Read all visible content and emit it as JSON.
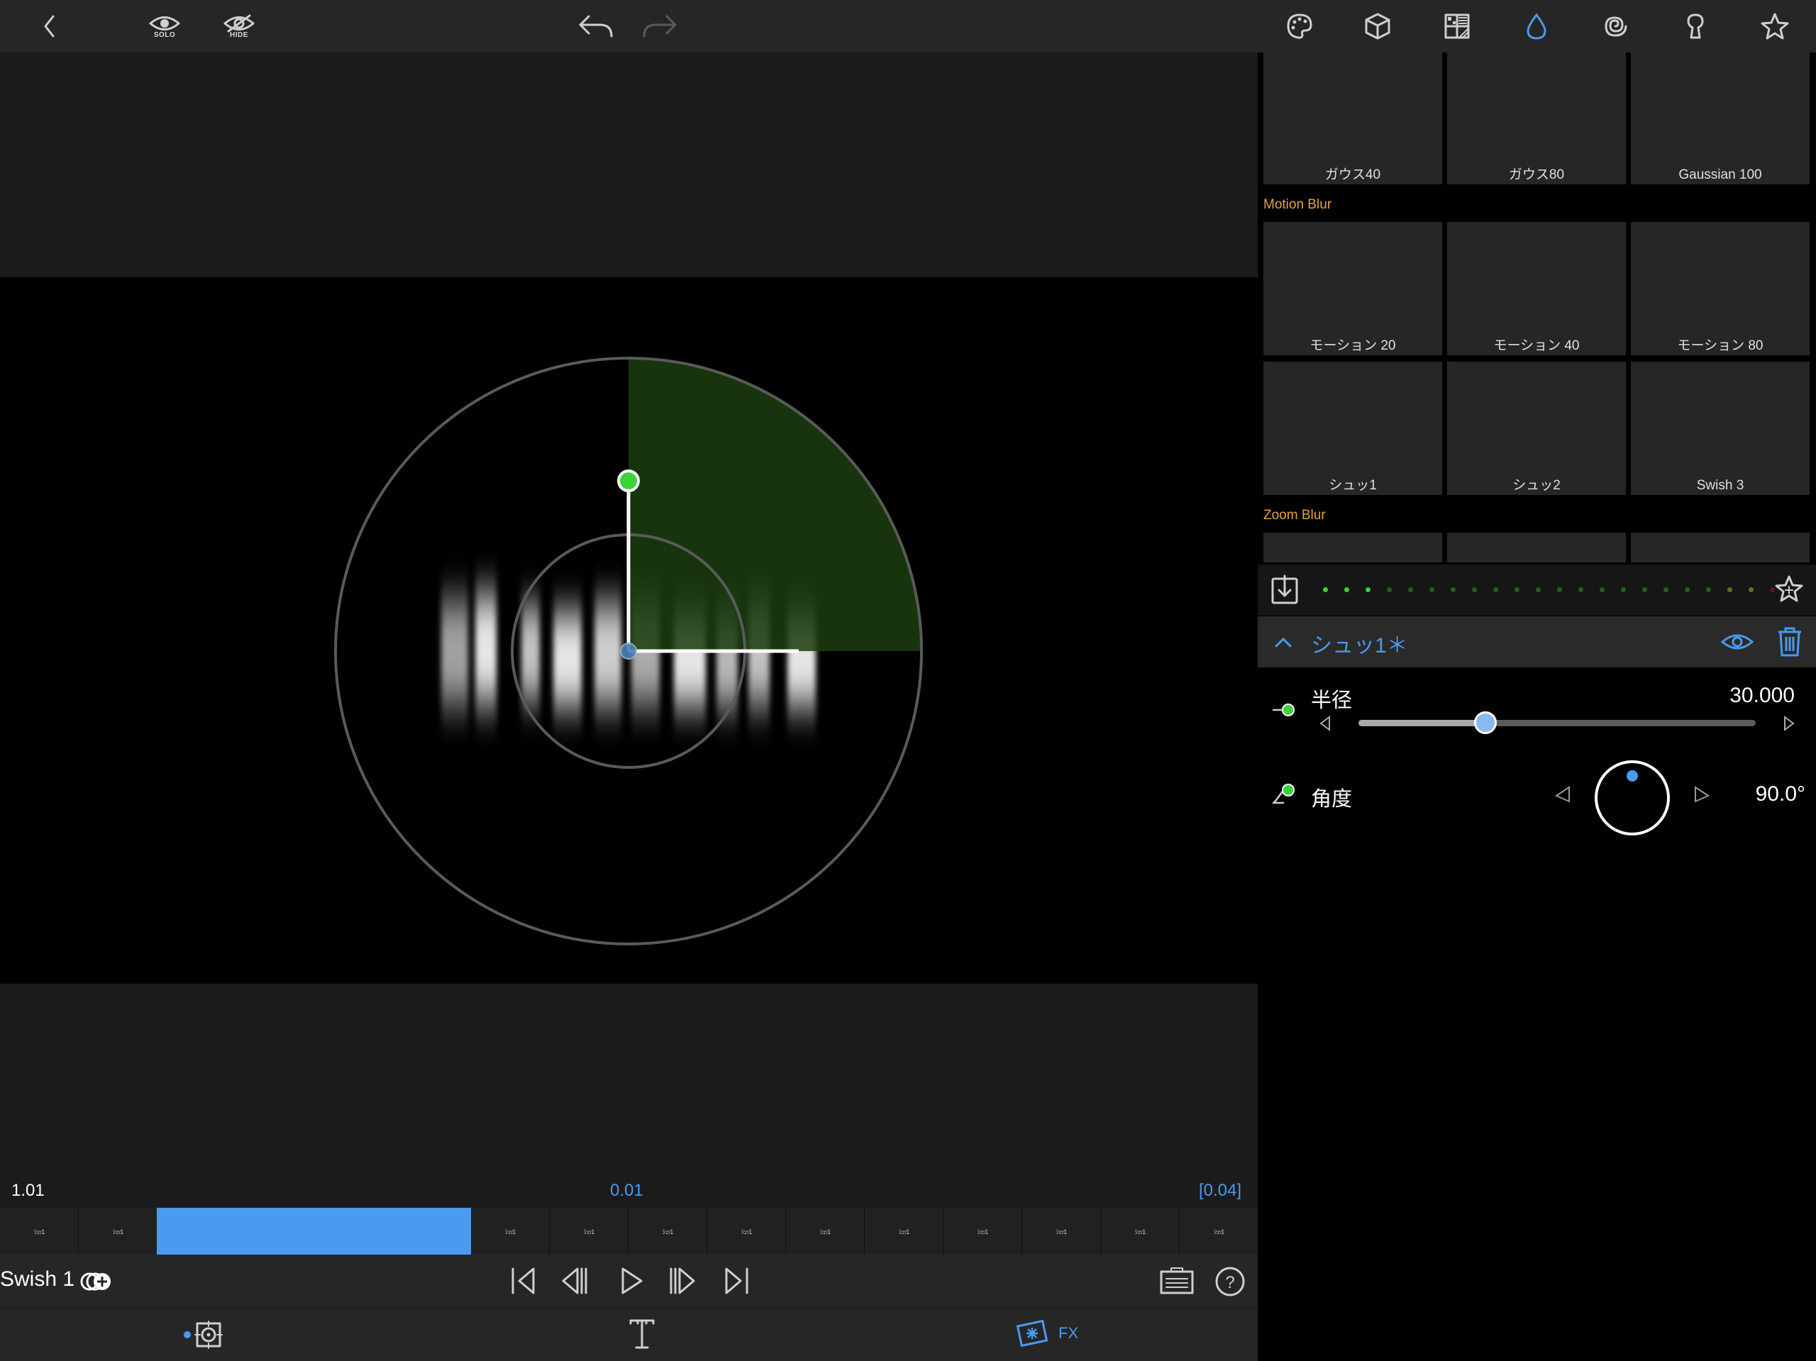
{
  "top_bar": {
    "solo_label": "SOLO",
    "hide_label": "HIDE",
    "right_icons": [
      "palette-icon",
      "cube-icon",
      "pattern-grid-icon",
      "drop-icon",
      "spiral-icon",
      "keyhole-icon",
      "star-icon"
    ],
    "active_icon": "drop-icon",
    "accent_color": "#4a9af0"
  },
  "presets": {
    "row1": [
      "ガウス40",
      "ガウス80",
      "Gaussian 100"
    ],
    "motion_category": "Motion Blur",
    "row2": [
      "モーション 20",
      "モーション 40",
      "モーション 80"
    ],
    "row3": [
      "シュッ1",
      "シュッ2",
      "Swish 3"
    ],
    "zoom_category": "Zoom Blur",
    "category_color": "#e5a33a"
  },
  "effect": {
    "title": "シュッ1＊",
    "radius_label": "半径",
    "radius_value": "30.000",
    "radius_fraction": 0.32,
    "angle_label": "角度",
    "angle_value": "90.0°"
  },
  "timeline": {
    "left_value": "1.01",
    "center_value": "0.01",
    "right_value": "[0.04]",
    "clip_label": "ｼｭｯ1"
  },
  "transport": {
    "layer_name": "Swish 1"
  },
  "bottom": {
    "fx_label": "FX"
  }
}
